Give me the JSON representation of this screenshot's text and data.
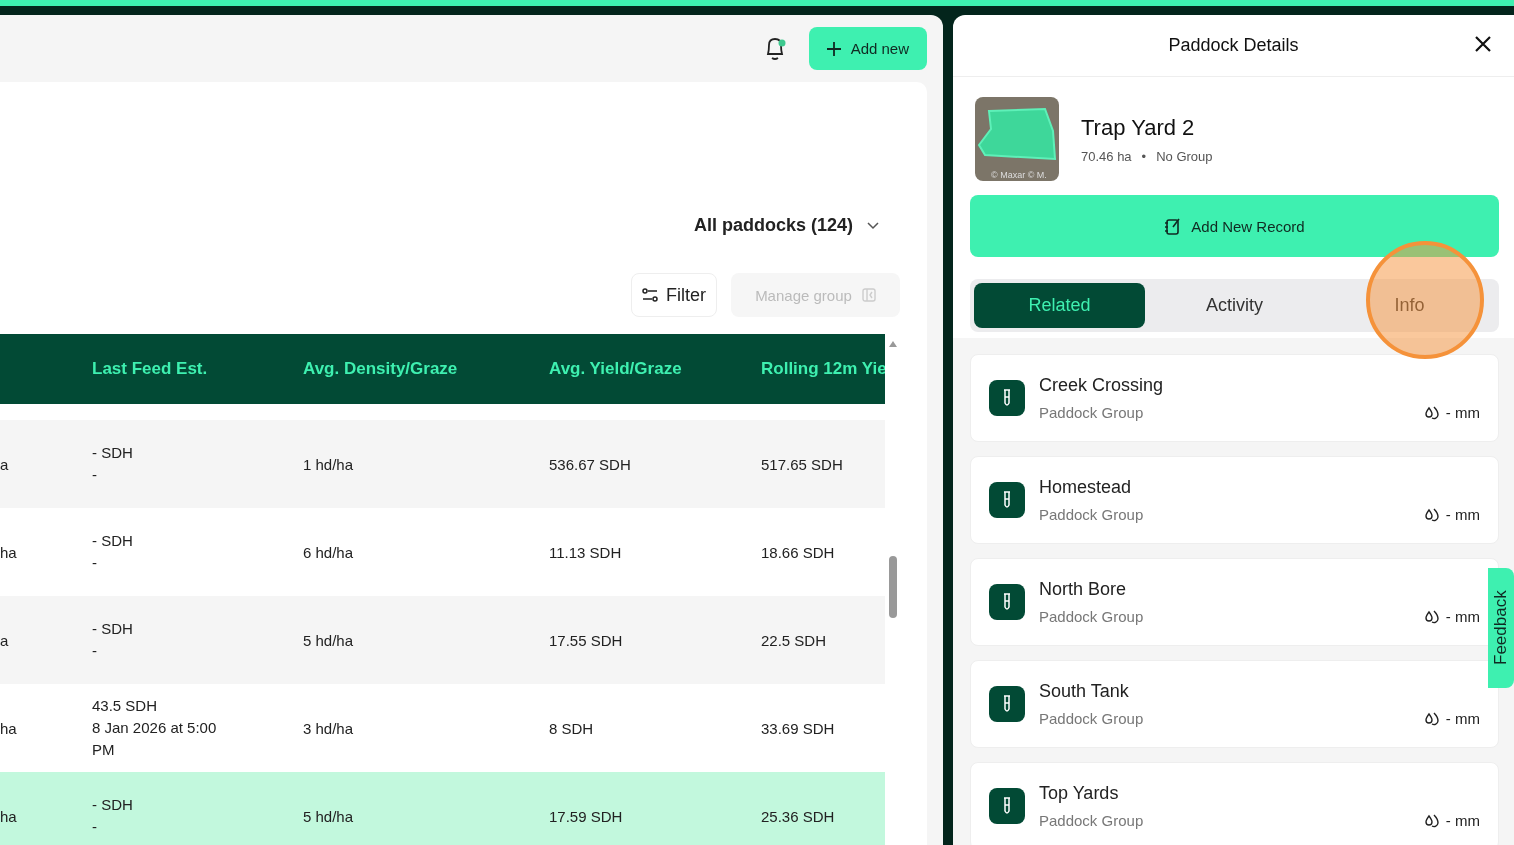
{
  "header": {
    "add_button": "Add new",
    "notification_dot": true
  },
  "paddock_selector": {
    "label": "All paddocks (124)"
  },
  "toolbar": {
    "filter": "Filter",
    "manage_group": {
      "label": "Manage group",
      "disabled": true
    }
  },
  "table": {
    "columns": [
      "",
      "Last Feed Est.",
      "Avg. Density/Graze",
      "Avg. Yield/Graze",
      "Rolling 12m Yie"
    ],
    "rows": [
      {
        "cells": [
          "a",
          {
            "value": "- SDH",
            "date": "-"
          },
          "1 hd/ha",
          "536.67 SDH",
          "517.65 SDH"
        ],
        "selected": false
      },
      {
        "cells": [
          "ha",
          {
            "value": "- SDH",
            "date": "-"
          },
          "6 hd/ha",
          "11.13 SDH",
          "18.66 SDH"
        ],
        "selected": false
      },
      {
        "cells": [
          "a",
          {
            "value": "- SDH",
            "date": "-"
          },
          "5 hd/ha",
          "17.55 SDH",
          "22.5 SDH"
        ],
        "selected": false
      },
      {
        "cells": [
          "ha",
          {
            "value": "43.5 SDH",
            "date": "8 Jan 2026 at 5:00 PM"
          },
          "3 hd/ha",
          "8 SDH",
          "33.69 SDH"
        ],
        "selected": false
      },
      {
        "cells": [
          "ha",
          {
            "value": "- SDH",
            "date": "-"
          },
          "5 hd/ha",
          "17.59 SDH",
          "25.36 SDH"
        ],
        "selected": true
      }
    ]
  },
  "details": {
    "title": "Paddock Details",
    "name": "Trap Yard 2",
    "area": "70.46 ha",
    "separator": "•",
    "group": "No Group",
    "map_credit": "© Maxar © M.",
    "add_record": "Add New Record",
    "tabs": [
      {
        "label": "Related",
        "selected": true
      },
      {
        "label": "Activity",
        "selected": false
      },
      {
        "label": "Info",
        "selected": false
      }
    ],
    "related": [
      {
        "name": "Creek Crossing",
        "type": "Paddock Group",
        "rain": "- mm"
      },
      {
        "name": "Homestead",
        "type": "Paddock Group",
        "rain": "- mm"
      },
      {
        "name": "North Bore",
        "type": "Paddock Group",
        "rain": "- mm"
      },
      {
        "name": "South Tank",
        "type": "Paddock Group",
        "rain": "- mm"
      },
      {
        "name": "Top Yards",
        "type": "Paddock Group",
        "rain": "- mm"
      }
    ]
  },
  "feedback": "Feedback"
}
